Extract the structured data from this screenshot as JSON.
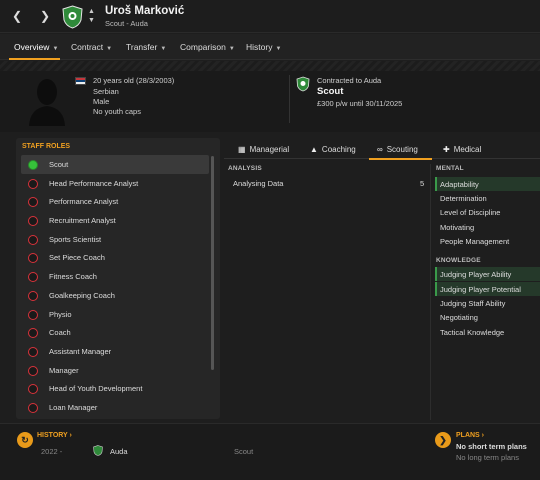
{
  "header": {
    "player_name": "Uroš Marković",
    "subtitle": "Scout - Auda"
  },
  "tabs": [
    {
      "label": "Overview"
    },
    {
      "label": "Contract"
    },
    {
      "label": "Transfer"
    },
    {
      "label": "Comparison"
    },
    {
      "label": "History"
    }
  ],
  "profile": {
    "age": "20 years old (28/3/2003)",
    "nationality": "Serbian",
    "gender": "Male",
    "caps": "No youth caps"
  },
  "contract": {
    "label": "Contracted to Auda",
    "role": "Scout",
    "terms": "£300 p/w until 30/11/2025"
  },
  "staff_roles": {
    "title": "STAFF ROLES",
    "items": [
      {
        "label": "Scout",
        "active": true
      },
      {
        "label": "Head Performance Analyst"
      },
      {
        "label": "Performance Analyst"
      },
      {
        "label": "Recruitment Analyst"
      },
      {
        "label": "Sports Scientist"
      },
      {
        "label": "Set Piece Coach"
      },
      {
        "label": "Fitness Coach"
      },
      {
        "label": "Goalkeeping Coach"
      },
      {
        "label": "Physio"
      },
      {
        "label": "Coach"
      },
      {
        "label": "Assistant Manager"
      },
      {
        "label": "Manager"
      },
      {
        "label": "Head of Youth Development"
      },
      {
        "label": "Loan Manager"
      }
    ]
  },
  "attr_tabs": [
    {
      "label": "Managerial",
      "icon": "briefcase-icon"
    },
    {
      "label": "Coaching",
      "icon": "cones-icon"
    },
    {
      "label": "Scouting",
      "icon": "binoculars-icon"
    },
    {
      "label": "Medical",
      "icon": "medical-cross-icon"
    }
  ],
  "analysis": {
    "title": "ANALYSIS",
    "name": "Analysing Data",
    "value": "5"
  },
  "mental": {
    "title": "MENTAL",
    "items": [
      {
        "label": "Adaptability",
        "highlight": true
      },
      {
        "label": "Determination"
      },
      {
        "label": "Level of Discipline"
      },
      {
        "label": "Motivating"
      },
      {
        "label": "People Management"
      }
    ]
  },
  "knowledge": {
    "title": "KNOWLEDGE",
    "items": [
      {
        "label": "Judging Player Ability",
        "highlight": true
      },
      {
        "label": "Judging Player Potential",
        "highlight": true
      },
      {
        "label": "Judging Staff Ability"
      },
      {
        "label": "Negotiating"
      },
      {
        "label": "Tactical Knowledge"
      }
    ]
  },
  "history": {
    "title": "HISTORY",
    "year": "2022 -",
    "club": "Auda",
    "role": "Scout"
  },
  "plans": {
    "title": "PLANS",
    "short": "No short term plans",
    "long": "No long term plans"
  },
  "colors": {
    "accent": "#f0a020",
    "club_green": "#2f8a3a",
    "active_dot": "#36c23a",
    "inactive_dot": "#d8323a"
  }
}
